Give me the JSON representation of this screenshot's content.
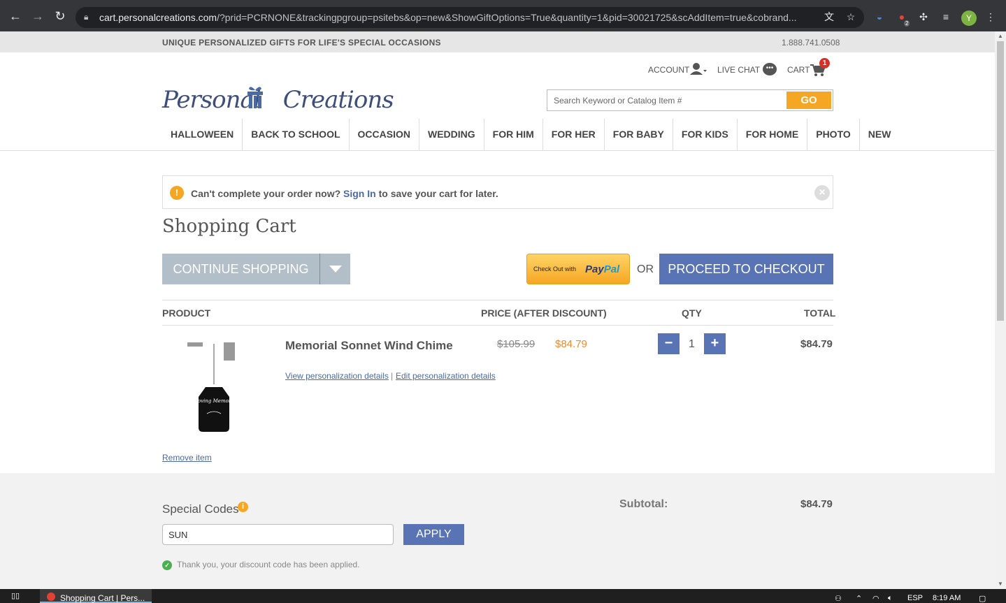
{
  "browser": {
    "url_host": "cart.personalcreations.com",
    "url_rest": "/?prid=PCRNONE&trackingpgroup=psitebs&op=new&ShowGiftOptions=True&quantity=1&pid=30021725&scAddItem=true&cobrand...",
    "profile_initial": "Y",
    "ext_badge": "2"
  },
  "header": {
    "tagline": "UNIQUE PERSONALIZED GIFTS FOR LIFE'S SPECIAL OCCASIONS",
    "phone": "1.888.741.0508",
    "account_label": "ACCOUNT",
    "livechat_label": "LIVE CHAT",
    "cart_label": "CART",
    "cart_count": "1",
    "logo_text_left": "Personal",
    "logo_text_right": "Creations",
    "search_placeholder": "Search Keyword or Catalog Item #",
    "go_label": "GO"
  },
  "nav": {
    "items": [
      "HALLOWEEN",
      "BACK TO SCHOOL",
      "OCCASION",
      "WEDDING",
      "FOR HIM",
      "FOR HER",
      "FOR BABY",
      "FOR KIDS",
      "FOR HOME",
      "PHOTO",
      "NEW"
    ]
  },
  "notice": {
    "prefix": "Can't complete your order now? ",
    "link": "Sign In",
    "suffix": " to save your cart for later."
  },
  "cart": {
    "title": "Shopping Cart",
    "continue_label": "CONTINUE SHOPPING",
    "paypal_prefix": "Check Out with",
    "paypal_pay": "Pay",
    "paypal_pal": "Pal",
    "or_label": "OR",
    "checkout_label": "PROCEED TO CHECKOUT",
    "columns": {
      "product": "PRODUCT",
      "price": "PRICE (AFTER DISCOUNT)",
      "qty": "QTY",
      "total": "TOTAL"
    },
    "item": {
      "name": "Memorial Sonnet Wind Chime",
      "price_original": "$105.99",
      "price_discounted": "$84.79",
      "qty": "1",
      "total": "$84.79",
      "view_link": "View personalization details",
      "edit_link": "Edit personalization details",
      "remove_link": "Remove item",
      "image_text": "In Loving Memory of"
    },
    "codes_label": "Special Codes",
    "code_value": "SUN",
    "apply_label": "APPLY",
    "code_message": "Thank you, your discount code has been applied.",
    "subtotal_label": "Subtotal:",
    "subtotal_value": "$84.79"
  },
  "taskbar": {
    "app_title": "Shopping Cart | Pers...",
    "lang": "ESP",
    "time": "8:19 AM"
  },
  "colors": {
    "accent_blue": "#5874b4",
    "accent_orange": "#f5a623",
    "sale_orange": "#f08a2a"
  }
}
